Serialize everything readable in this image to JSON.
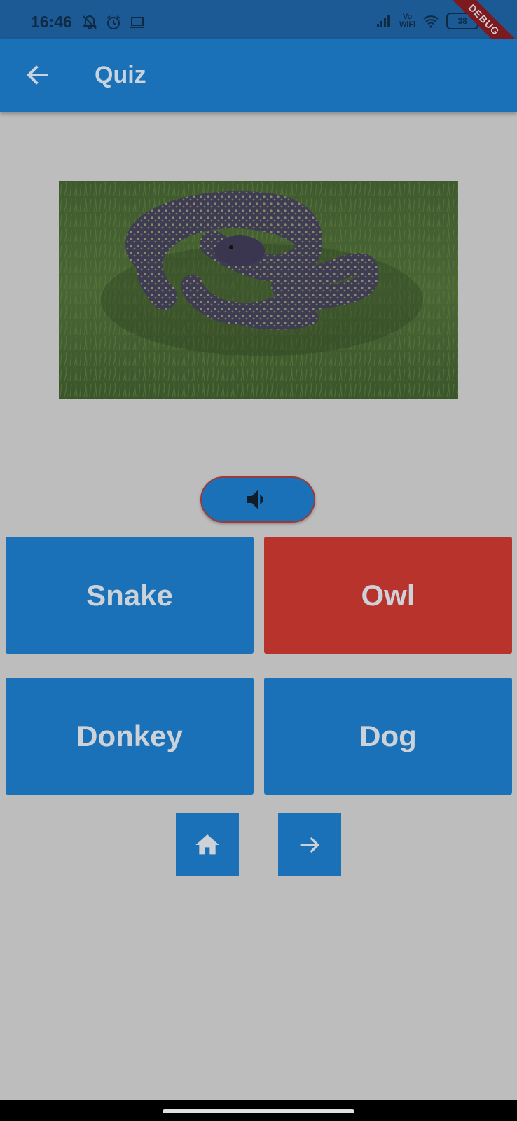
{
  "status_bar": {
    "time": "16:46",
    "vowifi_top": "Vo",
    "vowifi_bottom": "WiFi",
    "battery": "38"
  },
  "debug_banner": "DEBUG",
  "app_bar": {
    "title": "Quiz",
    "back_icon": "arrow-back-icon"
  },
  "quiz": {
    "image_subject": "snake-on-grass",
    "sound_icon": "volume-icon",
    "answers": [
      "Snake",
      "Owl",
      "Donkey",
      "Dog"
    ]
  },
  "nav": {
    "home_icon": "home-icon",
    "next_icon": "arrow-forward-icon"
  },
  "colors": {
    "primary": "#1a71b8",
    "wrong_answer": "#b8332b",
    "background": "#bdbdbd"
  }
}
